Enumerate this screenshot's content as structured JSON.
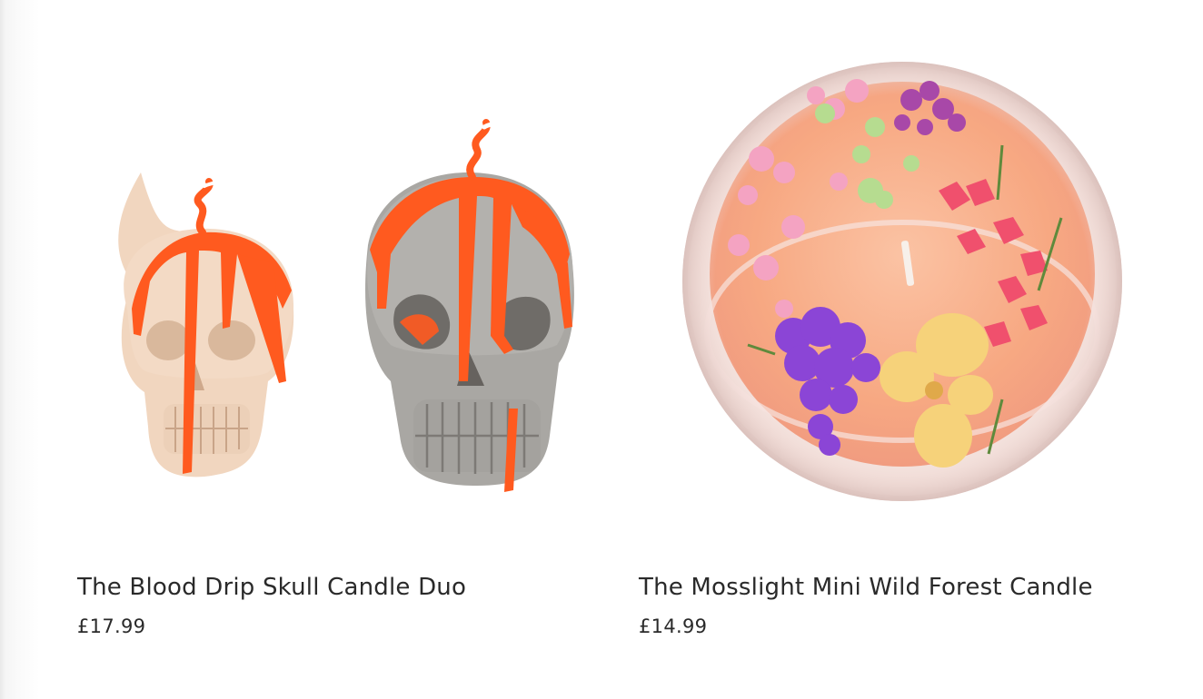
{
  "products": [
    {
      "title": "The Blood Drip Skull Candle Duo",
      "price": "£17.99",
      "image_icon": "skull-candle-duo-image"
    },
    {
      "title": "The Mosslight Mini Wild Forest Candle",
      "price": "£14.99",
      "image_icon": "flower-bowl-candle-image"
    }
  ],
  "colors": {
    "text": "#2a2a2a",
    "drip": "#ff5a1f",
    "candle_peach": "#f7a882"
  }
}
